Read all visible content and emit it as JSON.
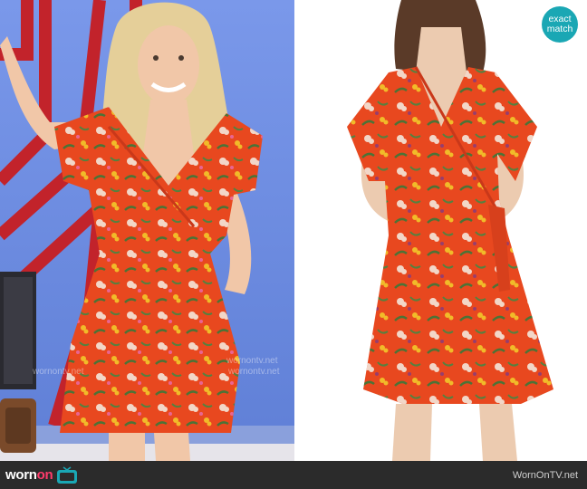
{
  "brand": {
    "word_1": "worn",
    "word_2": "on",
    "tv_icon": "tv-icon"
  },
  "site_url": "WornOnTV.net",
  "badge": {
    "line_1": "exact",
    "line_2": "match"
  },
  "watermark_text": "wornontv.net",
  "colors": {
    "dress": "#e8481f",
    "backdrop_blue": "#6f8fe0",
    "set_red": "#c2232b",
    "badge": "#1aa7b4",
    "footer": "#2b2b2b"
  }
}
